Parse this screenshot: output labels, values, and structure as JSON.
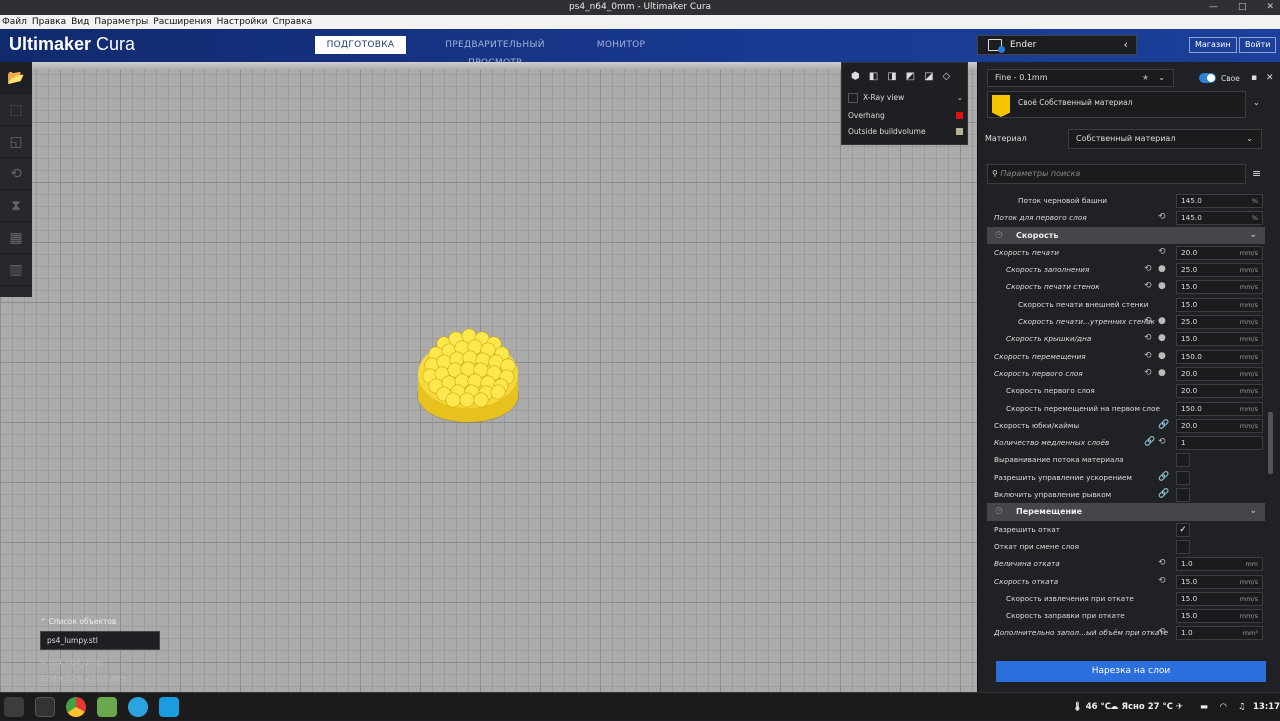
{
  "window": {
    "title": "ps4_n64_0mm - Ultimaker Cura"
  },
  "menu": [
    "Файл",
    "Правка",
    "Вид",
    "Параметры",
    "Расширения",
    "Настройки",
    "Справка"
  ],
  "header": {
    "logo_a": "Ultimaker",
    "logo_b": " Cura",
    "tabs": [
      "ПОДГОТОВКА",
      "ПРЕДВАРИТЕЛЬНЫЙ ПРОСМОТР",
      "МОНИТОР"
    ],
    "printer": "Ender",
    "market": "Магазин",
    "login": "Войти"
  },
  "view_panel": {
    "xray": "X-Ray view",
    "overhang": "Overhang",
    "outside": "Outside buildvolume",
    "overhang_color": "#e01010",
    "outside_color": "#b7b293"
  },
  "objects": {
    "title": "Список объектов",
    "file": "ps4_lumpy.stl",
    "job": "ps4_n64_0mm",
    "dims": "22.0 x 22.0 x 10.5 mm"
  },
  "panel": {
    "profile": "Fine - 0.1mm",
    "custom": "Свое",
    "material_header": "Своё Собственный материал",
    "material_label": "Материал",
    "material_value": "Собственный материал",
    "search_placeholder": "Параметры поиска",
    "slice": "Нарезка на слои"
  },
  "settings": [
    {
      "t": "row",
      "l": "Поток черновой башни",
      "i": 2,
      "it": false,
      "v": "145.0",
      "u": "%"
    },
    {
      "t": "row",
      "l": "Поток для первого слоя",
      "i": 0,
      "it": true,
      "v": "145.0",
      "u": "%",
      "ic": [
        "reset"
      ]
    },
    {
      "t": "head",
      "l": "Скорость"
    },
    {
      "t": "row",
      "l": "Скорость печати",
      "i": 0,
      "it": true,
      "v": "20.0",
      "u": "mm/s",
      "ic": [
        "reset"
      ]
    },
    {
      "t": "row",
      "l": "Скорость заполнения",
      "i": 1,
      "it": true,
      "v": "25.0",
      "u": "mm/s",
      "ic": [
        "reset",
        "info"
      ]
    },
    {
      "t": "row",
      "l": "Скорость печати стенок",
      "i": 1,
      "it": true,
      "v": "15.0",
      "u": "mm/s",
      "ic": [
        "reset",
        "info"
      ]
    },
    {
      "t": "row",
      "l": "Скорость печати внешней стенки",
      "i": 2,
      "it": false,
      "v": "15.0",
      "u": "mm/s"
    },
    {
      "t": "row",
      "l": "Скорость печати...утренних стенок",
      "i": 2,
      "it": true,
      "v": "25.0",
      "u": "mm/s",
      "ic": [
        "reset",
        "info"
      ]
    },
    {
      "t": "row",
      "l": "Скорость крышки/дна",
      "i": 1,
      "it": true,
      "v": "15.0",
      "u": "mm/s",
      "ic": [
        "reset",
        "info"
      ]
    },
    {
      "t": "row",
      "l": "Скорость перемещения",
      "i": 0,
      "it": true,
      "v": "150.0",
      "u": "mm/s",
      "ic": [
        "reset",
        "info"
      ]
    },
    {
      "t": "row",
      "l": "Скорость первого слоя",
      "i": 0,
      "it": true,
      "v": "20.0",
      "u": "mm/s",
      "ic": [
        "reset",
        "info"
      ]
    },
    {
      "t": "row",
      "l": "Скорость первого слоя",
      "i": 1,
      "it": false,
      "v": "20.0",
      "u": "mm/s"
    },
    {
      "t": "row",
      "l": "Скорость перемещений на первом слое",
      "i": 1,
      "it": false,
      "v": "150.0",
      "u": "mm/s"
    },
    {
      "t": "row",
      "l": "Скорость юбки/каймы",
      "i": 0,
      "it": false,
      "v": "20.0",
      "u": "mm/s",
      "ic": [
        "link"
      ]
    },
    {
      "t": "row",
      "l": "Количество медленных слоёв",
      "i": 0,
      "it": true,
      "v": "1",
      "u": "",
      "ic": [
        "link",
        "reset"
      ]
    },
    {
      "t": "cb",
      "l": "Выравнивание потока материала",
      "i": 0,
      "it": false,
      "c": false
    },
    {
      "t": "cb",
      "l": "Разрешить управление ускорением",
      "i": 0,
      "it": false,
      "c": false,
      "ic": [
        "link"
      ]
    },
    {
      "t": "cb",
      "l": "Включить управление рывком",
      "i": 0,
      "it": false,
      "c": false,
      "ic": [
        "link"
      ]
    },
    {
      "t": "head",
      "l": "Перемещение"
    },
    {
      "t": "cb",
      "l": "Разрешить откат",
      "i": 0,
      "it": false,
      "c": true
    },
    {
      "t": "cb",
      "l": "Откат при смене слоя",
      "i": 0,
      "it": false,
      "c": false
    },
    {
      "t": "row",
      "l": "Величина отката",
      "i": 0,
      "it": true,
      "v": "1.0",
      "u": "mm",
      "ic": [
        "reset"
      ]
    },
    {
      "t": "row",
      "l": "Скорость отката",
      "i": 0,
      "it": true,
      "v": "15.0",
      "u": "mm/s",
      "ic": [
        "reset"
      ]
    },
    {
      "t": "row",
      "l": "Скорость извлечения при откате",
      "i": 1,
      "it": false,
      "v": "15.0",
      "u": "mm/s"
    },
    {
      "t": "row",
      "l": "Скорость заправки при откате",
      "i": 1,
      "it": false,
      "v": "15.0",
      "u": "mm/s"
    },
    {
      "t": "row",
      "l": "Дополнительно запол...ый объём при откате",
      "i": 0,
      "it": true,
      "v": "1.0",
      "u": "mm³",
      "ic": [
        "reset"
      ]
    }
  ],
  "taskbar": {
    "temp": "46 °C",
    "weather": "Ясно 27 °C",
    "time": "13:17"
  }
}
